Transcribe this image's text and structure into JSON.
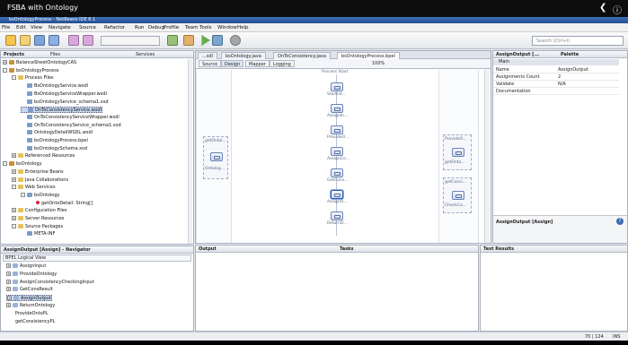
{
  "video_bar": {
    "title": "FSBA with Ontology"
  },
  "window": {
    "title": "bsOntologyProcess - NetBeans IDE 6.1"
  },
  "menu": [
    "File",
    "Edit",
    "View",
    "Navigate",
    "Source",
    "Refactor",
    "Run",
    "Debug",
    "Profile",
    "Team",
    "Tools",
    "Window",
    "Help"
  ],
  "search": {
    "placeholder": "Search (Ctrl+I)"
  },
  "projects": {
    "tabs": [
      "Projects",
      "Files",
      "Services"
    ],
    "tree": [
      {
        "label": "BalanceSheetOntologyCAS",
        "level": 0,
        "exp": "+",
        "kind": "proj",
        "y": 0
      },
      {
        "label": "bsOntologyProcess",
        "level": 0,
        "exp": "-",
        "kind": "proj",
        "y": 1
      },
      {
        "label": "Process Files",
        "level": 1,
        "exp": "-",
        "kind": "folder",
        "y": 2
      },
      {
        "label": "BsOntologyService.wsdl",
        "level": 2,
        "exp": "",
        "kind": "file",
        "y": 3
      },
      {
        "label": "BsOntologyServiceWrapper.wsdl",
        "level": 2,
        "exp": "",
        "kind": "file",
        "y": 4
      },
      {
        "label": "bsOntologyService_schema1.xsd",
        "level": 2,
        "exp": "",
        "kind": "file",
        "y": 5
      },
      {
        "label": "OnToConsistencyService.wsdl",
        "level": 2,
        "exp": "",
        "kind": "file",
        "y": 6,
        "selected": true
      },
      {
        "label": "OnToConsistencyServiceWrapper.wsdl",
        "level": 2,
        "exp": "",
        "kind": "file",
        "y": 7
      },
      {
        "label": "OnToConsistencyService_schema1.xsd",
        "level": 2,
        "exp": "",
        "kind": "file",
        "y": 8
      },
      {
        "label": "OntologyDetailWSDL.wsdl",
        "level": 2,
        "exp": "",
        "kind": "file",
        "y": 9
      },
      {
        "label": "bsOntologyProcess.bpel",
        "level": 2,
        "exp": "",
        "kind": "file",
        "y": 10
      },
      {
        "label": "bsOntologySchema.xsd",
        "level": 2,
        "exp": "",
        "kind": "file",
        "y": 11
      },
      {
        "label": "Referenced Resources",
        "level": 1,
        "exp": "+",
        "kind": "folder",
        "y": 12
      },
      {
        "label": "bsOntology",
        "level": 0,
        "exp": "-",
        "kind": "proj",
        "y": 13
      },
      {
        "label": "Enterprise Beans",
        "level": 1,
        "exp": "+",
        "kind": "folder",
        "y": 14
      },
      {
        "label": "Java Collaborations",
        "level": 1,
        "exp": "+",
        "kind": "folder",
        "y": 15
      },
      {
        "label": "Web Services",
        "level": 1,
        "exp": "-",
        "kind": "folder",
        "y": 16
      },
      {
        "label": "bsOntology",
        "level": 2,
        "exp": "-",
        "kind": "file",
        "y": 17
      },
      {
        "label": "getOntoDetail: String[]",
        "level": 3,
        "exp": "",
        "kind": "op",
        "y": 18
      },
      {
        "label": "Configuration Files",
        "level": 1,
        "exp": "+",
        "kind": "folder",
        "y": 19
      },
      {
        "label": "Server Resources",
        "level": 1,
        "exp": "+",
        "kind": "folder",
        "y": 20
      },
      {
        "label": "Source Packages",
        "level": 1,
        "exp": "-",
        "kind": "folder",
        "y": 21
      },
      {
        "label": "META-INF",
        "level": 2,
        "exp": "",
        "kind": "file",
        "y": 22
      }
    ]
  },
  "navigator": {
    "title": "AssignOutput [Assign] - Navigator",
    "view": "BPEL Logical View",
    "items": [
      "AssignInput",
      "ProvideOntology",
      "AssignConsistencyCheckingInput",
      "GetConsResult",
      "AssignOutput",
      "ReturnOntology",
      "ProvideOntoPL",
      "getConsistencyPL"
    ]
  },
  "editor": {
    "tabs": [
      "...sdl",
      "bsOntology.java",
      "OnToConsistency.java",
      "bsOntologyProcess.bpel"
    ],
    "views": [
      "Source",
      "Design",
      "Mapper",
      "Logging"
    ],
    "zoom": "100%",
    "process_start": "Process Start",
    "nodes": [
      "StartInt...",
      "AssignIn...",
      "ProvideO...",
      "AssignCo...",
      "GetCons...",
      "AssignO...",
      "ReturnO..."
    ],
    "partner_left": {
      "name": "getOntol...",
      "sub": "Ontolog..."
    },
    "partner_right": [
      {
        "name": "ProvideO...",
        "sub": "getOnto..."
      },
      {
        "name": "getConsi...",
        "sub": "CheckCo..."
      }
    ]
  },
  "properties": {
    "title": "AssignOutput [...",
    "palette": "Palette",
    "section": "Main",
    "rows": [
      [
        "Name",
        "AssignOutput"
      ],
      [
        "Assignments Count",
        "2"
      ],
      [
        "Validate",
        "N/A"
      ],
      [
        "Documentation",
        ""
      ]
    ],
    "help_title": "AssignOutput [Assign]"
  },
  "bottom": {
    "output": "Output",
    "tasks": "Tasks",
    "tests": "Test Results"
  },
  "status": {
    "position": "70 | 124",
    "mode": "INS"
  }
}
